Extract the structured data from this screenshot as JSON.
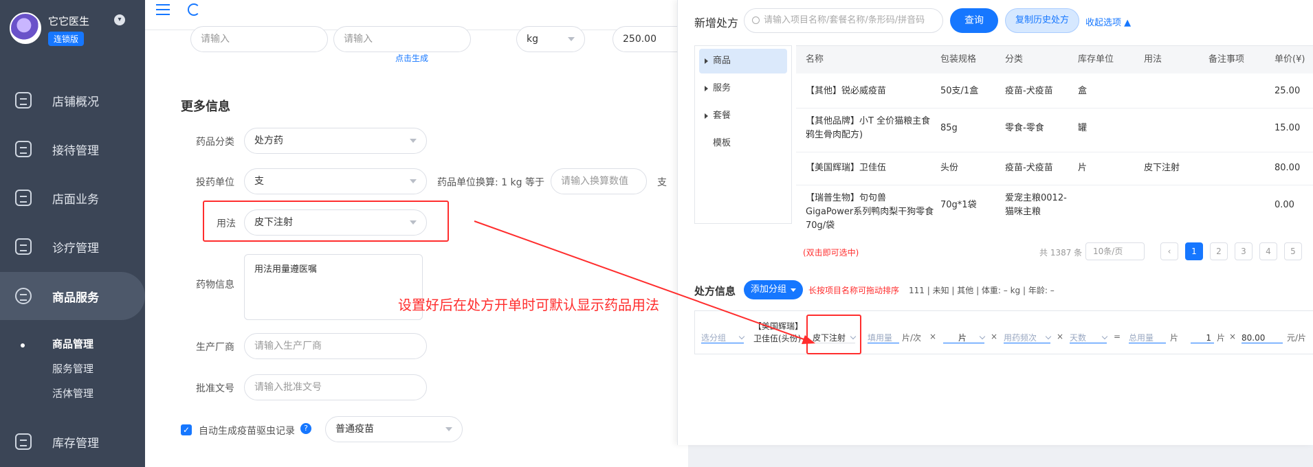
{
  "sidebar": {
    "brand_name": "它它医生",
    "brand_badge": "连锁版",
    "items": [
      {
        "label": "店铺概况"
      },
      {
        "label": "接待管理"
      },
      {
        "label": "店面业务"
      },
      {
        "label": "诊疗管理"
      },
      {
        "label": "商品服务"
      },
      {
        "label": "库存管理"
      }
    ],
    "sub_items": [
      {
        "label": "商品管理"
      },
      {
        "label": "服务管理"
      },
      {
        "label": "活体管理"
      }
    ]
  },
  "form": {
    "top_inputs": [
      {
        "placeholder": "请输入"
      },
      {
        "placeholder": "请输入"
      },
      {
        "value": "kg"
      },
      {
        "value": "250.00"
      }
    ],
    "generate_link": "点击生成",
    "section_title": "更多信息",
    "category_label": "药品分类",
    "category_value": "处方药",
    "unit_label": "投药单位",
    "unit_value": "支",
    "conversion_label": "药品单位换算: 1 kg 等于",
    "conversion_placeholder": "请输入换算数值",
    "conversion_suffix": "支",
    "usage_label": "用法",
    "usage_value": "皮下注射",
    "info_label": "药物信息",
    "info_value": "用法用量遵医嘱",
    "manufacturer_label": "生产厂商",
    "manufacturer_placeholder": "请输入生产厂商",
    "approval_label": "批准文号",
    "approval_placeholder": "请输入批准文号",
    "auto_record_label": "自动生成疫苗驱虫记录",
    "help_glyph": "?",
    "vaccine_value": "普通疫苗",
    "annotation": "设置好后在处方开单时可默认显示药品用法"
  },
  "panel": {
    "title": "新增处方",
    "search_placeholder": "请输入项目名称/套餐名称/条形码/拼音码",
    "query_button": "查询",
    "copy_button": "复制历史处方",
    "collapse_link": "收起选项 ▲",
    "categories": [
      "商品",
      "服务",
      "套餐",
      "模板"
    ],
    "columns": [
      "名称",
      "包装规格",
      "分类",
      "库存单位",
      "用法",
      "备注事项",
      "单价(¥)"
    ],
    "rows": [
      {
        "name": "【其他】锐必威疫苗",
        "spec": "50支/1盒",
        "cat": "疫苗-犬疫苗",
        "unit": "盒",
        "usage": "",
        "note": "",
        "price": "25.00"
      },
      {
        "name": "【其他品牌】小T 全价猫粮主食鸦生骨肉配方)",
        "spec": "85g",
        "cat": "零食-零食",
        "unit": "罐",
        "usage": "",
        "note": "",
        "price": "15.00"
      },
      {
        "name": "【美国辉瑞】卫佳伍",
        "spec": "头份",
        "cat": "疫苗-犬疫苗",
        "unit": "片",
        "usage": "皮下注射",
        "note": "",
        "price": "80.00"
      },
      {
        "name": "【瑞普生物】句句兽 GigaPower系列鸭肉梨干狗零食 70g/袋",
        "spec": "70g*1袋",
        "cat": "爱宠主粮0012-猫咪主粮",
        "unit": "",
        "usage": "",
        "note": "",
        "price": "0.00"
      }
    ],
    "hint": "(双击即可选中)",
    "total": "共 1387 条",
    "page_size": "10条/页",
    "pages": [
      "1",
      "2",
      "3",
      "4",
      "5"
    ],
    "rx_title": "处方信息",
    "add_group_button": "添加分组",
    "drag_hint": "长按项目名称可拖动排序",
    "patient_info": "111 | 未知 | 其他 | 体重: – kg | 年龄: –",
    "rx_row": {
      "group": "选分组",
      "item_name": "【美国辉瑞】卫佳伍(头份)",
      "usage": "皮下注射",
      "dose_placeholder": "填用量",
      "dose_unit": "片/次",
      "unit_select": "片",
      "freq_placeholder": "用药频次",
      "days_placeholder": "天数",
      "total_placeholder": "总用量",
      "total_unit": "片",
      "qty": "1",
      "qty_unit": "片",
      "price": "80.00",
      "price_unit": "元/片",
      "times": "×",
      "equals": "="
    }
  },
  "colors": {
    "accent": "#1677ff",
    "sidebar_bg": "#3b4556",
    "annotation_red": "#ff2d2d"
  }
}
